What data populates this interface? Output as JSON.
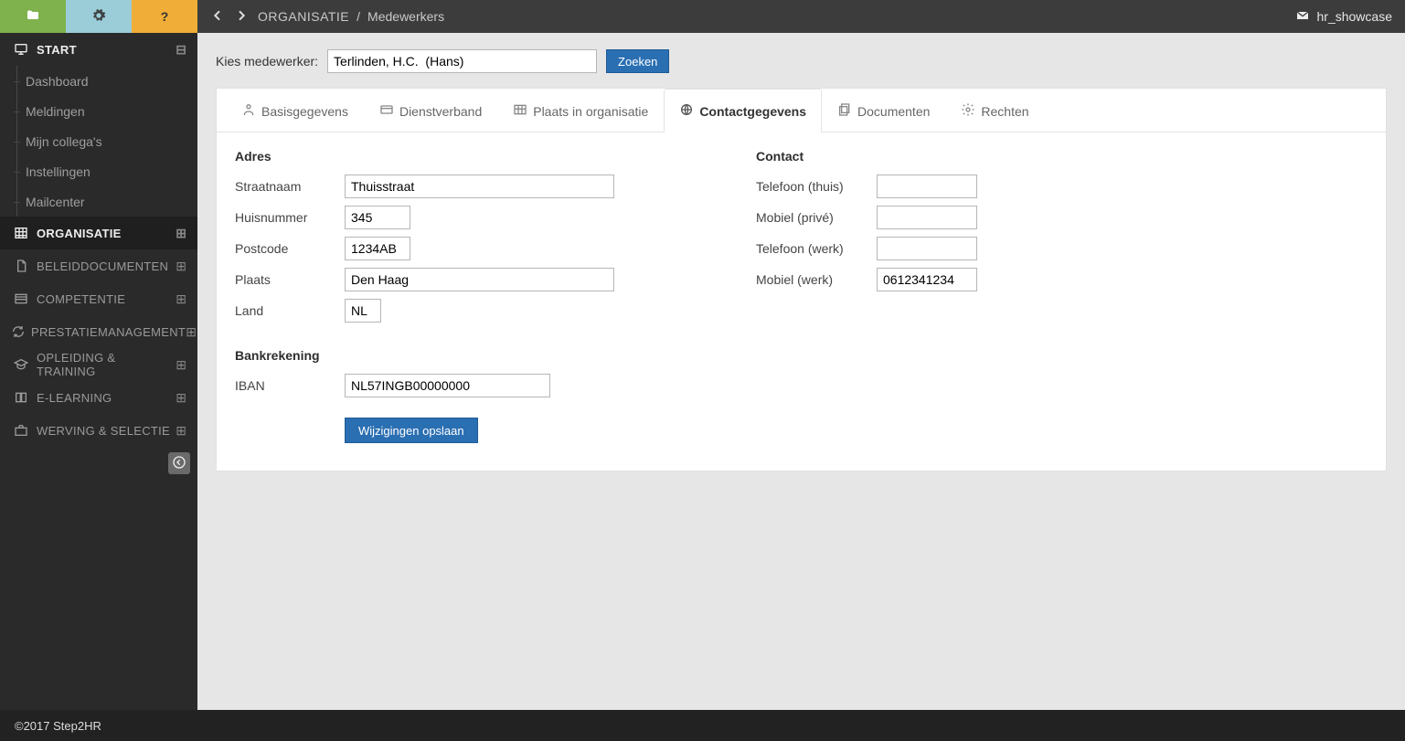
{
  "topbar": {
    "crumb1": "ORGANISATIE",
    "crumb2": "Medewerkers",
    "username": "hr_showcase"
  },
  "sidebar": {
    "start": {
      "label": "START",
      "items": [
        "Dashboard",
        "Meldingen",
        "Mijn collega's",
        "Instellingen",
        "Mailcenter"
      ]
    },
    "groups": [
      {
        "label": "ORGANISATIE",
        "active": true
      },
      {
        "label": "BELEIDDOCUMENTEN"
      },
      {
        "label": "COMPETENTIE"
      },
      {
        "label": "PRESTATIEMANAGEMENT"
      },
      {
        "label": "OPLEIDING & TRAINING"
      },
      {
        "label": "E-LEARNING"
      },
      {
        "label": "WERVING & SELECTIE"
      }
    ]
  },
  "search": {
    "label": "Kies medewerker:",
    "value": "Terlinden, H.C.  (Hans)",
    "button": "Zoeken"
  },
  "tabs": [
    "Basisgegevens",
    "Dienstverband",
    "Plaats in organisatie",
    "Contactgegevens",
    "Documenten",
    "Rechten"
  ],
  "address": {
    "title": "Adres",
    "labels": {
      "street": "Straatnaam",
      "number": "Huisnummer",
      "postcode": "Postcode",
      "city": "Plaats",
      "country": "Land"
    },
    "values": {
      "street": "Thuisstraat",
      "number": "345",
      "postcode": "1234AB",
      "city": "Den Haag",
      "country": "NL"
    }
  },
  "contact": {
    "title": "Contact",
    "labels": {
      "phone_home": "Telefoon (thuis)",
      "mobile_priv": "Mobiel (privé)",
      "phone_work": "Telefoon (werk)",
      "mobile_work": "Mobiel (werk)"
    },
    "values": {
      "phone_home": "",
      "mobile_priv": "",
      "phone_work": "",
      "mobile_work": "0612341234"
    }
  },
  "bank": {
    "title": "Bankrekening",
    "labels": {
      "iban": "IBAN"
    },
    "values": {
      "iban": "NL57INGB00000000"
    }
  },
  "save_label": "Wijzigingen opslaan",
  "footer": "©2017 Step2HR"
}
